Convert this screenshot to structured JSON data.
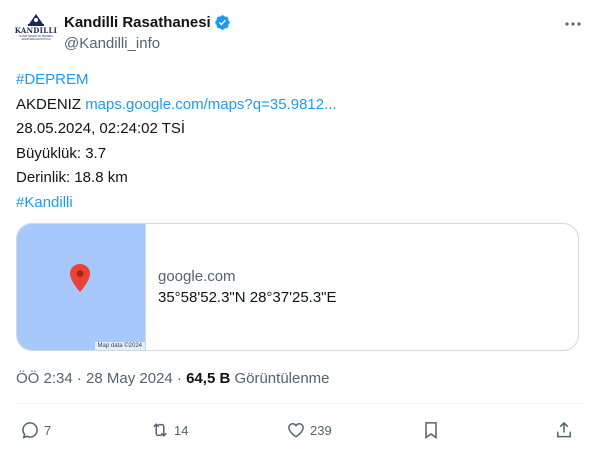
{
  "account": {
    "display_name": "Kandilli Rasathanesi",
    "handle": "@Kandilli_info",
    "logo_text": "KANDILLI",
    "logo_sub": "RASATHANESI VE DEPREM ARAŞTIRMA ENSTİTÜSÜ"
  },
  "tweet": {
    "hashtag_top": "#DEPREM",
    "region": "AKDENIZ",
    "map_link": "maps.google.com/maps?q=35.9812...",
    "datetime": "28.05.2024, 02:24:02 TSİ",
    "magnitude": "Büyüklük: 3.7",
    "depth": "Derinlik: 18.8 km",
    "hashtag_bottom": "#Kandilli"
  },
  "card": {
    "domain": "google.com",
    "coords": "35°58'52.3\"N 28°37'25.3\"E",
    "map_credit": "Map data ©2024"
  },
  "meta": {
    "time": "ÖÖ 2:34 · 28 May 2024 · ",
    "views_count": "64,5 B",
    "views_label": " Görüntülenme"
  },
  "actions": {
    "replies": "7",
    "retweets": "14",
    "likes": "239"
  },
  "colors": {
    "link": "#1d9bf0",
    "verified": "#1d9bf0",
    "pin": "#ea4335",
    "map": "#a8c7fa"
  }
}
